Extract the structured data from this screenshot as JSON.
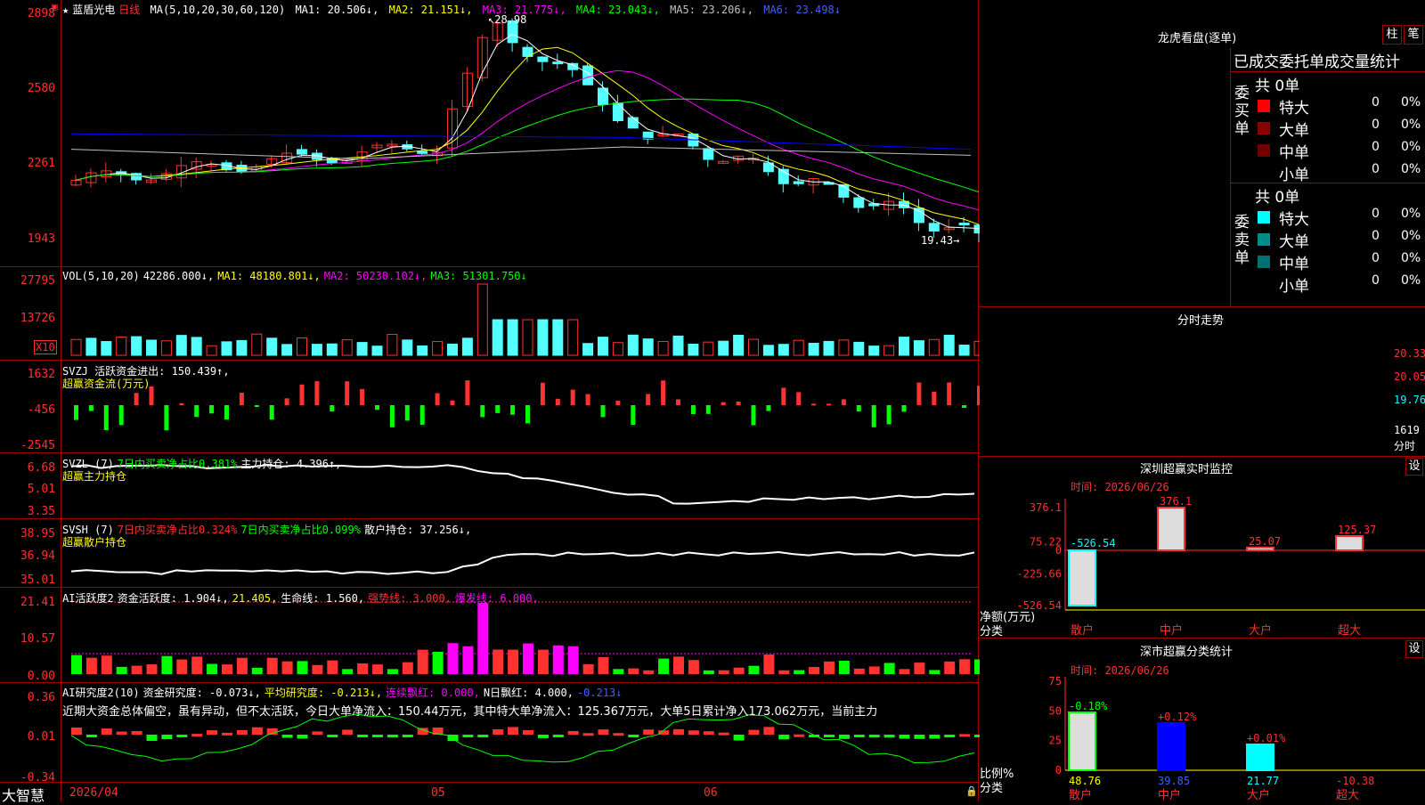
{
  "colors": {
    "up": "#ff3232",
    "down": "#54ffff",
    "ma1": "#ffffff",
    "ma2": "#ffff00",
    "ma3": "#ff00ff",
    "ma4": "#00ff00",
    "ma5": "#c0c0c0",
    "ma6": "#0000ff",
    "grid": "#a00000"
  },
  "header": {
    "star": "★",
    "stock": "蓝盾光电",
    "period": "日线",
    "ma_params": "MA(5,10,20,30,60,120)",
    "ma1": "MA1: 20.506↓,",
    "ma2": "MA2: 21.151↓,",
    "ma3": "MA3: 21.775↓,",
    "ma4": "MA4: 23.043↓,",
    "ma5": "MA5: 23.206↓,",
    "ma6": "MA6: 23.498↓"
  },
  "price_axis": [
    "2898",
    "2580",
    "2261",
    "1943"
  ],
  "price_markers": {
    "high": "28.98",
    "low": "19.43"
  },
  "vol": {
    "title": "VOL(5,10,20)",
    "value": "42286.000↓,",
    "ma1": "MA1: 48180.801↓,",
    "ma2": "MA2: 50230.102↓,",
    "ma3": "MA3: 51301.750↓",
    "axis": [
      "27795",
      "13726"
    ],
    "unit": "X10"
  },
  "svzj": {
    "title": "SVZJ  活跃资金进出: 150.439↑,",
    "sub": "超赢资金流(万元)",
    "axis": [
      "1632",
      "-456",
      "-2545"
    ]
  },
  "svzl": {
    "title": "SVZL (7)",
    "a": "7日内买卖净占比0.381%",
    "b": "主力持仓: 4.396↑,",
    "sub": "超赢主力持仓",
    "axis": [
      "6.68",
      "5.01",
      "3.35"
    ]
  },
  "svsh": {
    "title": "SVSH (7)",
    "a": "7日内买卖净占比0.324%",
    "b": "7日内买卖净占比0.099%",
    "c": "散户持仓: 37.256↓,",
    "sub": "超赢散户持仓",
    "axis": [
      "38.95",
      "36.94",
      "35.01"
    ]
  },
  "ai1": {
    "title": "AI活跃度2",
    "a": "资金活跃度: 1.904↓,",
    "b": "21.405,",
    "c": "生命线: 1.560,",
    "d": "强势线: 3.000,",
    "e": "爆发线: 6.000,",
    "axis": [
      "21.41",
      "10.57",
      "0.00"
    ]
  },
  "ai2": {
    "title": "AI研究度2(10)",
    "a": "资金研究度: -0.073↓,",
    "b": "平均研究度: -0.213↓,",
    "c": "连续飘红: 0.000,",
    "d": "N日飘红: 4.000,",
    "e": "-0.213↓",
    "text": "近期大资金总体偏空，虽有异动，但不太活跃，今日大单净流入：150.44万元，其中特大单净流入：125.367万元，大单5日累计净入173.062万元，当前主力",
    "axis": [
      "0.36",
      "0.01",
      "-0.34"
    ]
  },
  "xaxis": [
    "2026/04",
    "05",
    "06"
  ],
  "brand": "大智慧",
  "dragon": {
    "title": "龙虎看盘(逐单)",
    "btn1": "柱",
    "btn2": "笔",
    "stat_title": "已成交委托单成交量统计",
    "buy": {
      "label": "委买单",
      "total": "共 0单",
      "rows": [
        {
          "name": "特大",
          "v": "0",
          "p": "0%",
          "c": "#ff0000"
        },
        {
          "name": "大单",
          "v": "0",
          "p": "0%",
          "c": "#8b0000"
        },
        {
          "name": "中单",
          "v": "0",
          "p": "0%",
          "c": "#700000"
        },
        {
          "name": "小单",
          "v": "0",
          "p": "0%",
          "c": "#000000"
        }
      ]
    },
    "sell": {
      "label": "委卖单",
      "total": "共 0单",
      "rows": [
        {
          "name": "特大",
          "v": "0",
          "p": "0%",
          "c": "#00ffff"
        },
        {
          "name": "大单",
          "v": "0",
          "p": "0%",
          "c": "#008b8b"
        },
        {
          "name": "中单",
          "v": "0",
          "p": "0%",
          "c": "#007070"
        },
        {
          "name": "小单",
          "v": "0",
          "p": "0%",
          "c": "#000000"
        }
      ]
    }
  },
  "intraday": {
    "title": "分时走势",
    "axis": [
      "20.33",
      "20.05",
      "19.76"
    ],
    "vol": "1619",
    "label": "分时"
  },
  "monitor": {
    "title": "深圳超赢实时监控",
    "set": "设",
    "time": "时间: 2026/06/26",
    "axis": [
      "376.1",
      "75.22",
      "0",
      "-225.66",
      "-526.54"
    ],
    "ylabel": "净额(万元)",
    "xlabel": "分类",
    "cats": [
      "散户",
      "中户",
      "大户",
      "超大"
    ],
    "vals": [
      -526.54,
      376.1,
      25.07,
      125.37
    ],
    "labels": [
      "-526.54",
      "376.1",
      "25.07",
      "125.37"
    ]
  },
  "classify": {
    "title": "深市超赢分类统计",
    "set": "设",
    "time": "时间: 2026/06/26",
    "axis": [
      "75",
      "50",
      "25",
      "0"
    ],
    "ylabel": "比例%",
    "xlabel": "分类",
    "cats": [
      "散户",
      "中户",
      "大户",
      "超大"
    ],
    "pct": [
      48.76,
      39.85,
      21.77,
      10.38
    ],
    "vals": [
      "48.76",
      "39.85",
      "21.77",
      "-10.38"
    ],
    "diffs": [
      "-0.18%",
      "+0.12%",
      "+0.01%",
      ""
    ]
  }
}
